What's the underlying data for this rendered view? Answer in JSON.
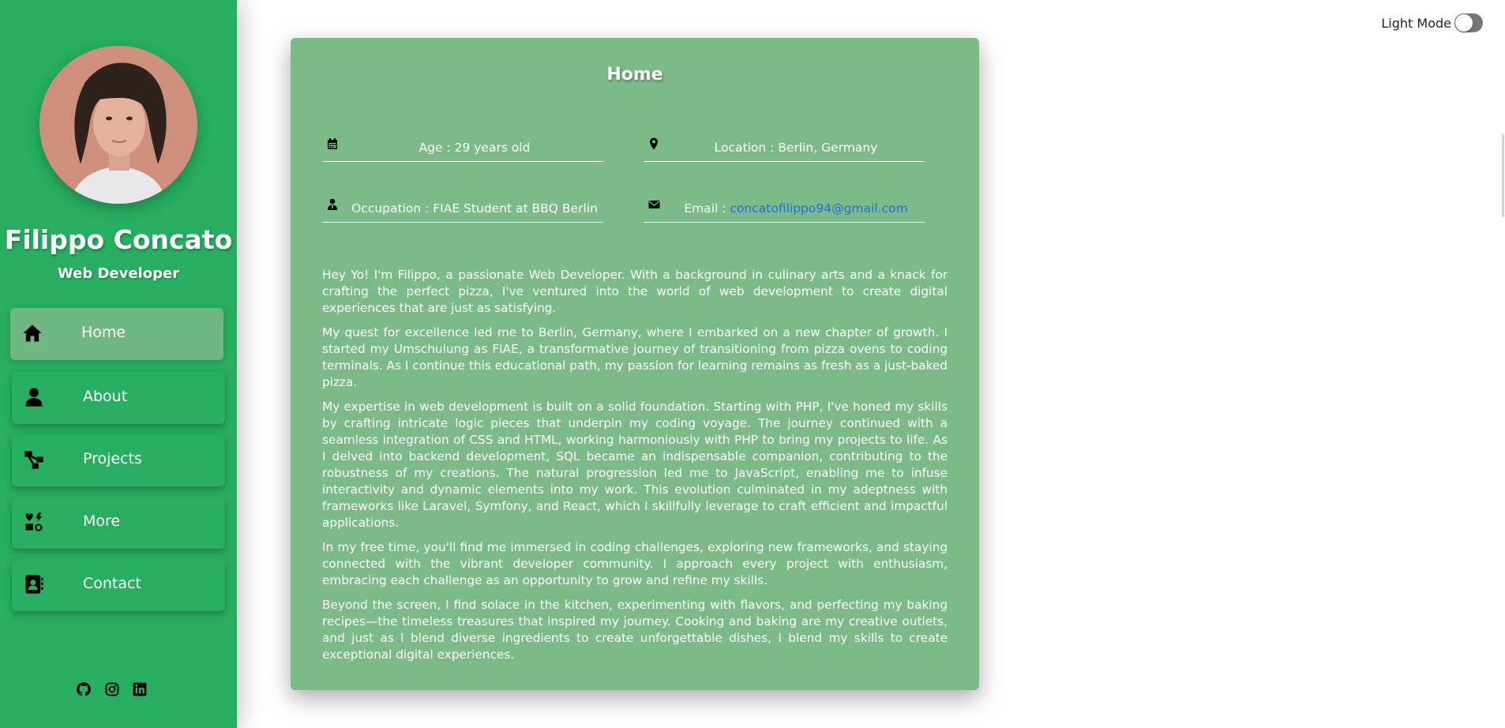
{
  "theme": {
    "sidebar_bg": "#27ae60",
    "card_bg": "#7cbb87",
    "active_nav_bg": "#6fb882",
    "link_color": "#1a73e8"
  },
  "profile": {
    "name": "Filippo Concato",
    "role": "Web Developer"
  },
  "nav": [
    {
      "label": "Home",
      "icon": "home-icon",
      "active": true
    },
    {
      "label": "About",
      "icon": "user-icon",
      "active": false
    },
    {
      "label": "Projects",
      "icon": "diagram-icon",
      "active": false
    },
    {
      "label": "More",
      "icon": "icons-icon",
      "active": false
    },
    {
      "label": "Contact",
      "icon": "address-book-icon",
      "active": false
    }
  ],
  "socials": [
    "github-icon",
    "instagram-icon",
    "linkedin-icon"
  ],
  "toggle": {
    "label": "Light Mode",
    "checked": false
  },
  "card": {
    "title": "Home",
    "age": "Age : 29 years old",
    "location": "Location : Berlin, Germany",
    "occupation": "Occupation : FIAE Student at BBQ Berlin",
    "email_prefix": "Email : ",
    "email": "concatofilippo94@gmail.com",
    "bio": [
      "Hey Yo! I'm Filippo, a passionate Web Developer. With a background in culinary arts and a knack for crafting the perfect pizza, I've ventured into the world of web development to create digital experiences that are just as satisfying.",
      "My quest for excellence led me to Berlin, Germany, where I embarked on a new chapter of growth. I started my Umschulung as FIAE, a transformative journey of transitioning from pizza ovens to coding terminals. As I continue this educational path, my passion for learning remains as fresh as a just-baked pizza.",
      "My expertise in web development is built on a solid foundation. Starting with PHP, I've honed my skills by crafting intricate logic pieces that underpin my coding voyage. The journey continued with a seamless integration of CSS and HTML, working harmoniously with PHP to bring my projects to life. As I delved into backend development, SQL became an indispensable companion, contributing to the robustness of my creations. The natural progression led me to JavaScript, enabling me to infuse interactivity and dynamic elements into my work. This evolution culminated in my adeptness with frameworks like Laravel, Symfony, and React, which I skillfully leverage to craft efficient and impactful applications.",
      "In my free time, you'll find me immersed in coding challenges, exploring new frameworks, and staying connected with the vibrant developer community. I approach every project with enthusiasm, embracing each challenge as an opportunity to grow and refine my skills.",
      "Beyond the screen, I find solace in the kitchen, experimenting with flavors, and perfecting my baking recipes—the timeless treasures that inspired my journey. Cooking and baking are my creative outlets, and just as I blend diverse ingredients to create unforgettable dishes, I blend my skills to create exceptional digital experiences."
    ]
  }
}
